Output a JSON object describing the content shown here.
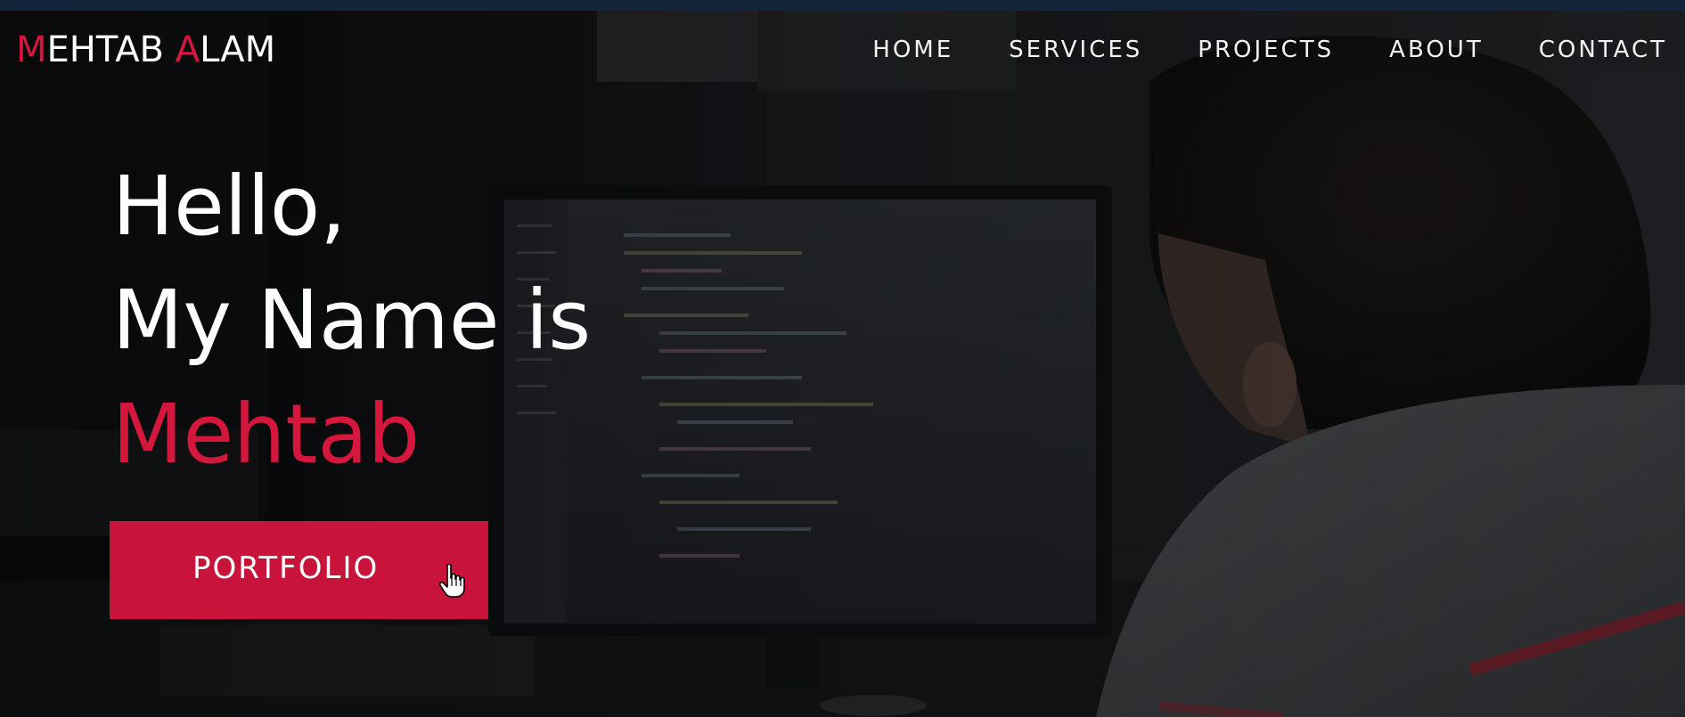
{
  "header": {
    "logo": {
      "first_initial": "M",
      "first_rest": "EHTAB ",
      "last_initial": "A",
      "last_rest": "LAM"
    },
    "nav": [
      {
        "label": "HOME"
      },
      {
        "label": "SERVICES"
      },
      {
        "label": "PROJECTS"
      },
      {
        "label": "ABOUT"
      },
      {
        "label": "CONTACT"
      }
    ]
  },
  "hero": {
    "line1": "Hello,",
    "line2": "My Name is",
    "name": "Mehtab",
    "button_label": "PORTFOLIO",
    "cursor": "hand-pointer-icon"
  },
  "colors": {
    "accent": "#d6173d",
    "button": "#c8133a",
    "text": "#ffffff",
    "topbar": "#14243a"
  }
}
